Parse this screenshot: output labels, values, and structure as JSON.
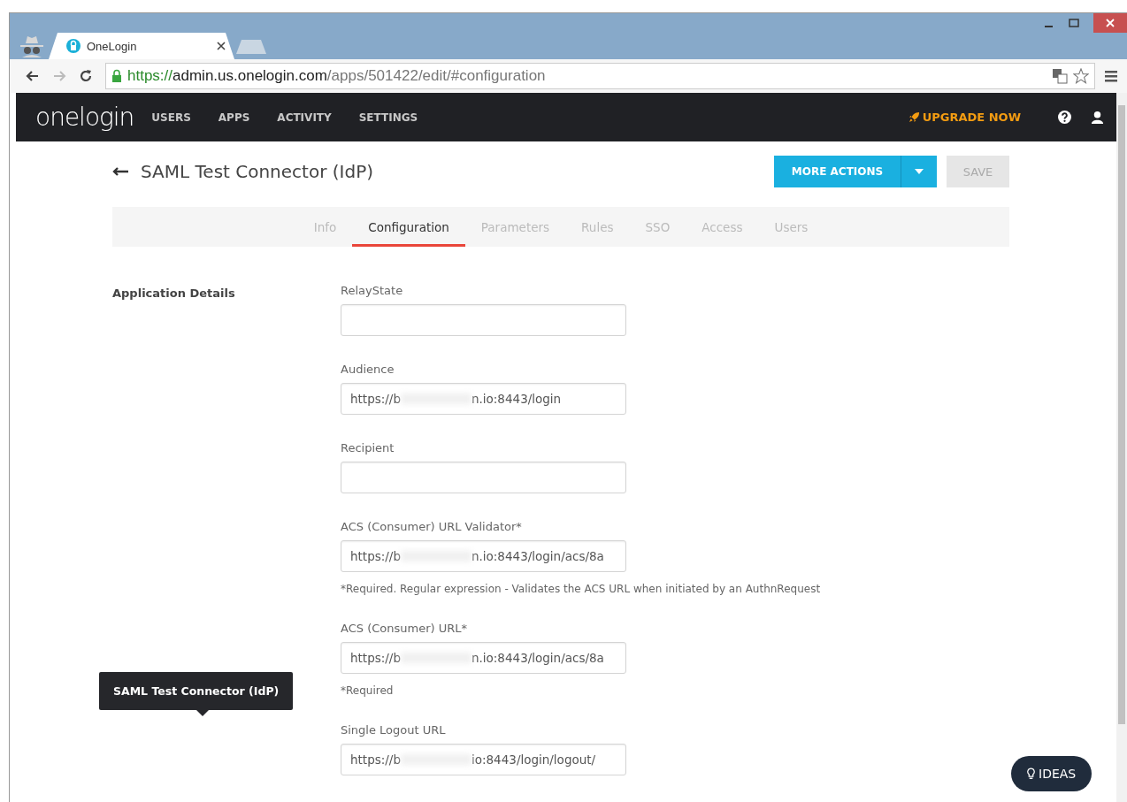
{
  "browser": {
    "tab_title": "OneLogin",
    "url": {
      "scheme": "https://",
      "host": "admin.us.onelogin.com",
      "path": "/apps/501422/edit/#configuration"
    }
  },
  "nav": {
    "logo": "onelogin",
    "items": [
      "USERS",
      "APPS",
      "ACTIVITY",
      "SETTINGS"
    ],
    "upgrade": "UPGRADE NOW"
  },
  "header": {
    "title": "SAML Test Connector (IdP)",
    "more_actions": "MORE ACTIONS",
    "save": "SAVE",
    "save_disabled": true
  },
  "tabs": [
    {
      "label": "Info",
      "selected": false
    },
    {
      "label": "Configuration",
      "selected": true
    },
    {
      "label": "Parameters",
      "selected": false
    },
    {
      "label": "Rules",
      "selected": false
    },
    {
      "label": "SSO",
      "selected": false
    },
    {
      "label": "Access",
      "selected": false
    },
    {
      "label": "Users",
      "selected": false
    }
  ],
  "section_title": "Application Details",
  "fields": [
    {
      "label": "RelayState"
    },
    {
      "label": "Audience",
      "value_parts": [
        "https://b",
        "n.io:8443/login"
      ]
    },
    {
      "label": "Recipient"
    },
    {
      "label": "ACS (Consumer) URL Validator*",
      "value_parts": [
        "https://b",
        "n.io:8443/login/acs/8a"
      ],
      "help": "*Required. Regular expression - Validates the ACS URL when initiated by an AuthnRequest"
    },
    {
      "label": "ACS (Consumer) URL*",
      "value_parts": [
        "https://b",
        "n.io:8443/login/acs/8a"
      ],
      "help": "*Required"
    },
    {
      "label": "Single Logout URL",
      "value_parts": [
        "https://b",
        "io:8443/login/logout/"
      ]
    }
  ],
  "tooltip": "SAML Test Connector (IdP)",
  "ideas_button": "IDEAS"
}
